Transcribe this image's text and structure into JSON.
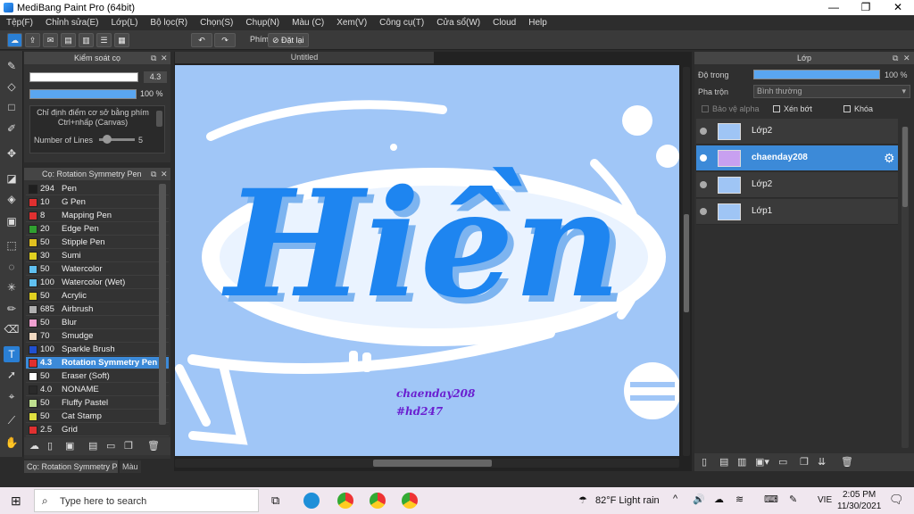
{
  "window": {
    "title": "MediBang Paint Pro (64bit)",
    "min": "—",
    "max": "❐",
    "close": "✕"
  },
  "menu": [
    "Tệp(F)",
    "Chỉnh sửa(E)",
    "Lớp(L)",
    "Bộ lọc(R)",
    "Chọn(S)",
    "Chụp(N)",
    "Màu (C)",
    "Xem(V)",
    "Công cụ(T)",
    "Cửa sổ(W)",
    "Cloud",
    "Help"
  ],
  "toolbar": {
    "shortcut_label": "Phím",
    "reset_label": "Đặt lại"
  },
  "brush_control": {
    "title": "Kiểm soát cọ",
    "size_value": "4.3",
    "opacity_value": "100 %",
    "hint": "Chỉ định điểm cơ sở bằng phím Ctrl+nhấp (Canvas)",
    "lines_label": "Number of Lines",
    "lines_value": "5"
  },
  "brush_list": {
    "title": "Cọ: Rotation Symmetry Pen",
    "items": [
      {
        "size": "294",
        "name": "Pen",
        "color": "#1f1f1f"
      },
      {
        "size": "10",
        "name": "G Pen",
        "color": "#e03030"
      },
      {
        "size": "8",
        "name": "Mapping Pen",
        "color": "#e03030"
      },
      {
        "size": "20",
        "name": "Edge Pen",
        "color": "#30a030"
      },
      {
        "size": "50",
        "name": "Stipple Pen",
        "color": "#e0c020"
      },
      {
        "size": "30",
        "name": "Sumi",
        "color": "#e0d020"
      },
      {
        "size": "50",
        "name": "Watercolor",
        "color": "#60c0f0"
      },
      {
        "size": "100",
        "name": "Watercolor (Wet)",
        "color": "#60c0f0"
      },
      {
        "size": "50",
        "name": "Acrylic",
        "color": "#e0d020"
      },
      {
        "size": "685",
        "name": "Airbrush",
        "color": "#b0b0b0"
      },
      {
        "size": "50",
        "name": "Blur",
        "color": "#f0a0d0"
      },
      {
        "size": "70",
        "name": "Smudge",
        "color": "#f0d8c0"
      },
      {
        "size": "100",
        "name": "Sparkle Brush",
        "color": "#2050d0"
      },
      {
        "size": "4.3",
        "name": "Rotation Symmetry Pen",
        "color": "#e03030"
      },
      {
        "size": "50",
        "name": "Eraser (Soft)",
        "color": "#ffffff"
      },
      {
        "size": "4.0",
        "name": "NONAME",
        "color": "#2a2a2a"
      },
      {
        "size": "50",
        "name": "Fluffy Pastel",
        "color": "#c0e090"
      },
      {
        "size": "50",
        "name": "Cat Stamp",
        "color": "#e0e040"
      },
      {
        "size": "2.5",
        "name": "Grid",
        "color": "#e03030"
      }
    ],
    "selected_index": 13
  },
  "bottom_tabs": {
    "brush_tab": "Cọ: Rotation Symmetry Pen",
    "color_tab": "Màu"
  },
  "document": {
    "tab_title": "Untitled",
    "artwork_text": "Hiền",
    "watermark1": "chaenday208",
    "watermark2": "#hd247"
  },
  "layers": {
    "title": "Lớp",
    "opacity_label": "Độ trong",
    "opacity_value": "100 %",
    "blend_label": "Pha trộn",
    "blend_value": "Bình thường",
    "protect_alpha": "Bảo vệ alpha",
    "clipping": "Xén bớt",
    "lock": "Khóa",
    "items": [
      {
        "name": "Lớp2",
        "selected": false
      },
      {
        "name": "chaenday208",
        "selected": true
      },
      {
        "name": "Lớp2",
        "selected": false
      },
      {
        "name": "Lớp1",
        "selected": false
      }
    ]
  },
  "taskbar": {
    "search_placeholder": "Type here to search",
    "weather": "82°F  Light rain",
    "lang": "VIE",
    "time": "2:05 PM",
    "date": "11/30/2021"
  }
}
